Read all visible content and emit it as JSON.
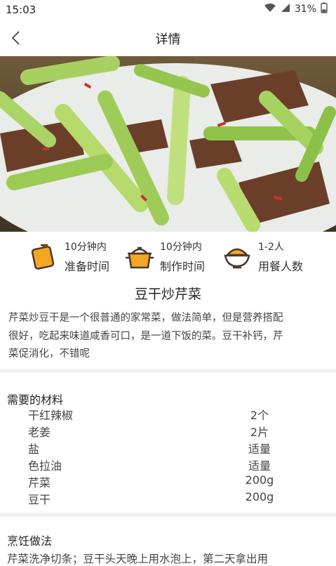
{
  "status": {
    "time": "15:03",
    "battery": "31%"
  },
  "nav": {
    "title": "详情"
  },
  "stats": [
    {
      "icon": "timer-icon",
      "value": "10分钟内",
      "label": "准备时间"
    },
    {
      "icon": "pot-icon",
      "value": "10分钟内",
      "label": "制作时间"
    },
    {
      "icon": "rice-bowl-icon",
      "value": "1-2人",
      "label": "用餐人数"
    }
  ],
  "dish": {
    "title": "豆干炒芹菜",
    "intro_lines": [
      "芹菜炒豆干是一个很普通的家常菜，做法简单，但是营养搭配",
      "很好，吃起来味道咸香可口，是一道下饭的菜。豆干补钙，芹",
      "菜促消化，不错呢"
    ]
  },
  "ingredients": {
    "title": "需要的材料",
    "items": [
      {
        "name": "干红辣椒",
        "amount": "2个"
      },
      {
        "name": "老姜",
        "amount": "2片"
      },
      {
        "name": "盐",
        "amount": "适量"
      },
      {
        "name": "色拉油",
        "amount": "适量"
      },
      {
        "name": "芹菜",
        "amount": "200g"
      },
      {
        "name": "豆干",
        "amount": "200g"
      }
    ]
  },
  "method": {
    "title": "烹饪做法",
    "first_step_preview": "芹菜洗净切条；豆干头天晚上用水泡上，第二天拿出用"
  },
  "colors": {
    "accent": "#f5a623",
    "icon_outline": "#4a3a2a",
    "divider": "#f2f2f2"
  }
}
